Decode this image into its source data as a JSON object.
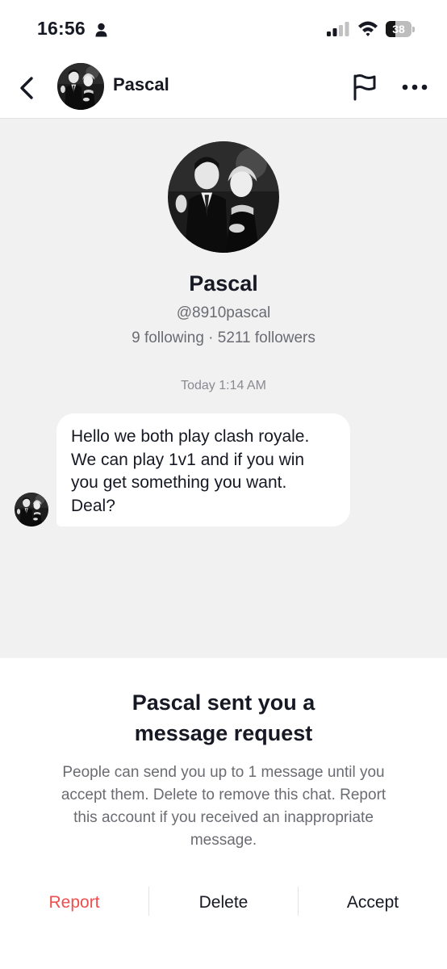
{
  "status_bar": {
    "time": "16:56",
    "battery_level": "38",
    "battery_fraction": 0.38
  },
  "header": {
    "name": "Pascal",
    "icons": [
      "back-icon",
      "avatar",
      "flag-icon",
      "more-icon"
    ]
  },
  "profile": {
    "name": "Pascal",
    "handle": "@8910pascal",
    "stats": "9 following · 5211 followers"
  },
  "chat": {
    "timestamp": "Today 1:14 AM",
    "message": {
      "lines": [
        "Hello we both play clash royale.",
        "We can play 1v1 and if you win",
        "you get something you want.",
        "Deal?"
      ]
    }
  },
  "request_sheet": {
    "title_lines": [
      "Pascal sent you a",
      "message request"
    ],
    "description_lines": [
      "People can send you up to 1 message until you",
      "accept them. Delete to remove this chat. Report",
      "this account if you received an inappropriate",
      "message."
    ],
    "actions": {
      "report": "Report",
      "delete": "Delete",
      "accept": "Accept"
    }
  },
  "colors": {
    "background": "#f1f1f2",
    "report_red": "#ee4e4e",
    "text_primary": "#161823",
    "text_secondary": "#6b6c72"
  }
}
